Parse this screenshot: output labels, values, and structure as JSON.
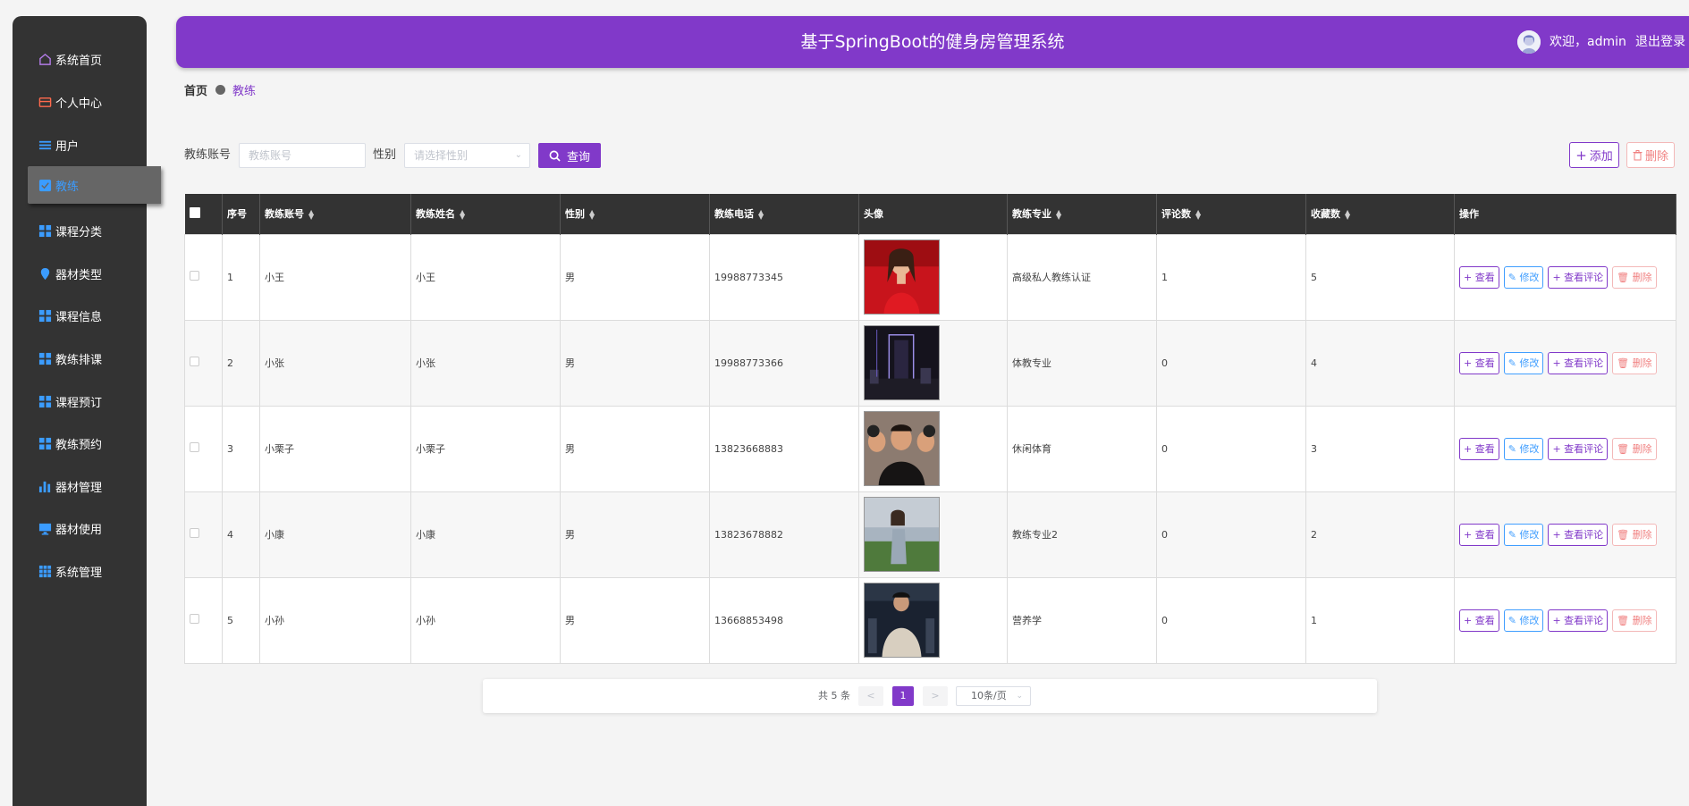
{
  "header": {
    "title": "基于SpringBoot的健身房管理系统",
    "welcome": "欢迎，admin",
    "logout": "退出登录"
  },
  "sidebar": {
    "items": [
      {
        "label": "系统首页",
        "icon": "home-icon"
      },
      {
        "label": "个人中心",
        "icon": "card-icon"
      },
      {
        "label": "用户",
        "icon": "list-icon"
      },
      {
        "label": "教练",
        "icon": "check-square-icon",
        "active": true
      },
      {
        "label": "课程分类",
        "icon": "grid-icon"
      },
      {
        "label": "器材类型",
        "icon": "location-pin-icon"
      },
      {
        "label": "课程信息",
        "icon": "grid-icon"
      },
      {
        "label": "教练排课",
        "icon": "grid-icon"
      },
      {
        "label": "课程预订",
        "icon": "grid-icon"
      },
      {
        "label": "教练预约",
        "icon": "grid-icon"
      },
      {
        "label": "器材管理",
        "icon": "bar-chart-icon"
      },
      {
        "label": "器材使用",
        "icon": "monitor-icon"
      },
      {
        "label": "系统管理",
        "icon": "apps-icon"
      }
    ]
  },
  "breadcrumb": {
    "home": "首页",
    "current": "教练"
  },
  "search": {
    "account_label": "教练账号",
    "account_placeholder": "教练账号",
    "gender_label": "性别",
    "gender_placeholder": "请选择性别",
    "query_label": "查询"
  },
  "toolbar": {
    "add_label": "添加",
    "delete_label": "删除"
  },
  "table": {
    "headers": [
      "序号",
      "教练账号",
      "教练姓名",
      "性别",
      "教练电话",
      "头像",
      "教练专业",
      "评论数",
      "收藏数",
      "操作"
    ],
    "rows": [
      {
        "index": "1",
        "account": "小王",
        "name": "小王",
        "gender": "男",
        "phone": "19988773345",
        "major": "高级私人教练认证",
        "comments": "1",
        "favorites": "5"
      },
      {
        "index": "2",
        "account": "小张",
        "name": "小张",
        "gender": "男",
        "phone": "19988773366",
        "major": "体教专业",
        "comments": "0",
        "favorites": "4"
      },
      {
        "index": "3",
        "account": "小栗子",
        "name": "小栗子",
        "gender": "男",
        "phone": "13823668883",
        "major": "休闲体育",
        "comments": "0",
        "favorites": "3"
      },
      {
        "index": "4",
        "account": "小康",
        "name": "小康",
        "gender": "男",
        "phone": "13823678882",
        "major": "教练专业2",
        "comments": "0",
        "favorites": "2"
      },
      {
        "index": "5",
        "account": "小孙",
        "name": "小孙",
        "gender": "男",
        "phone": "13668853498",
        "major": "营养学",
        "comments": "0",
        "favorites": "1"
      }
    ],
    "ops": {
      "view": "查看",
      "edit": "修改",
      "comments": "查看评论",
      "delete": "删除"
    }
  },
  "pagination": {
    "total": "共 5 条",
    "prev": "<",
    "current": "1",
    "next": ">",
    "page_size": "10条/页"
  },
  "colors": {
    "brand": "#8139c9",
    "sidebar": "#333333",
    "active_link": "#3b9cff",
    "edit": "#409eff",
    "danger": "#f08080"
  }
}
